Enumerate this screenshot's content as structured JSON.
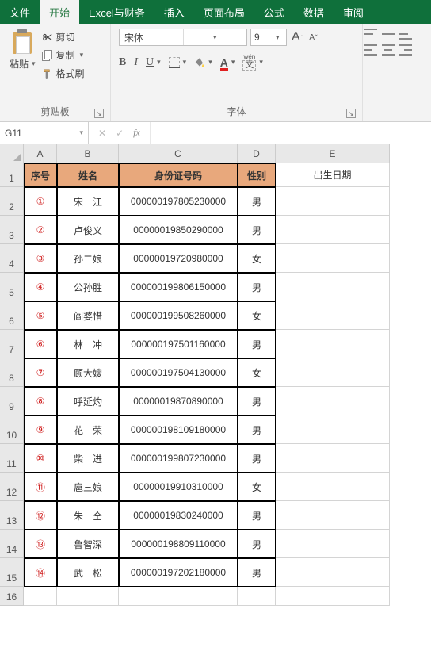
{
  "tabs": [
    "文件",
    "开始",
    "Excel与财务",
    "插入",
    "页面布局",
    "公式",
    "数据",
    "审阅"
  ],
  "active_tab": 1,
  "ribbon": {
    "clipboard": {
      "paste": "粘贴",
      "cut": "剪切",
      "copy": "复制",
      "format_painter": "格式刷",
      "group_label": "剪贴板"
    },
    "font": {
      "name": "宋体",
      "size": "9",
      "group_label": "字体",
      "bold": "B",
      "italic": "I",
      "underline": "U",
      "color_glyph": "A",
      "wen": "wén",
      "wen_char": "文"
    }
  },
  "namebox": "G11",
  "fx_label": "fx",
  "columns": [
    "A",
    "B",
    "C",
    "D",
    "E"
  ],
  "header_row": [
    "序号",
    "姓名",
    "身份证号码",
    "性别",
    "出生日期"
  ],
  "rows": [
    {
      "num": "1"
    },
    {
      "num": "2",
      "seq": "①",
      "name": "宋　江",
      "id": "000000197805230000",
      "sex": "男"
    },
    {
      "num": "3",
      "seq": "②",
      "name": "卢俊义",
      "id": "00000019850290000",
      "sex": "男"
    },
    {
      "num": "4",
      "seq": "③",
      "name": "孙二娘",
      "id": "00000019720980000",
      "sex": "女"
    },
    {
      "num": "5",
      "seq": "④",
      "name": "公孙胜",
      "id": "000000199806150000",
      "sex": "男"
    },
    {
      "num": "6",
      "seq": "⑤",
      "name": "阎婆惜",
      "id": "000000199508260000",
      "sex": "女"
    },
    {
      "num": "7",
      "seq": "⑥",
      "name": "林　冲",
      "id": "000000197501160000",
      "sex": "男"
    },
    {
      "num": "8",
      "seq": "⑦",
      "name": "顾大嫂",
      "id": "000000197504130000",
      "sex": "女"
    },
    {
      "num": "9",
      "seq": "⑧",
      "name": "呼延灼",
      "id": "00000019870890000",
      "sex": "男"
    },
    {
      "num": "10",
      "seq": "⑨",
      "name": "花　荣",
      "id": "000000198109180000",
      "sex": "男"
    },
    {
      "num": "11",
      "seq": "⑩",
      "name": "柴　进",
      "id": "000000199807230000",
      "sex": "男"
    },
    {
      "num": "12",
      "seq": "⑪",
      "name": "扈三娘",
      "id": "00000019910310000",
      "sex": "女"
    },
    {
      "num": "13",
      "seq": "⑫",
      "name": "朱　仝",
      "id": "00000019830240000",
      "sex": "男"
    },
    {
      "num": "14",
      "seq": "⑬",
      "name": "鲁智深",
      "id": "000000198809110000",
      "sex": "男"
    },
    {
      "num": "15",
      "seq": "⑭",
      "name": "武　松",
      "id": "000000197202180000",
      "sex": "男"
    },
    {
      "num": "16"
    }
  ]
}
